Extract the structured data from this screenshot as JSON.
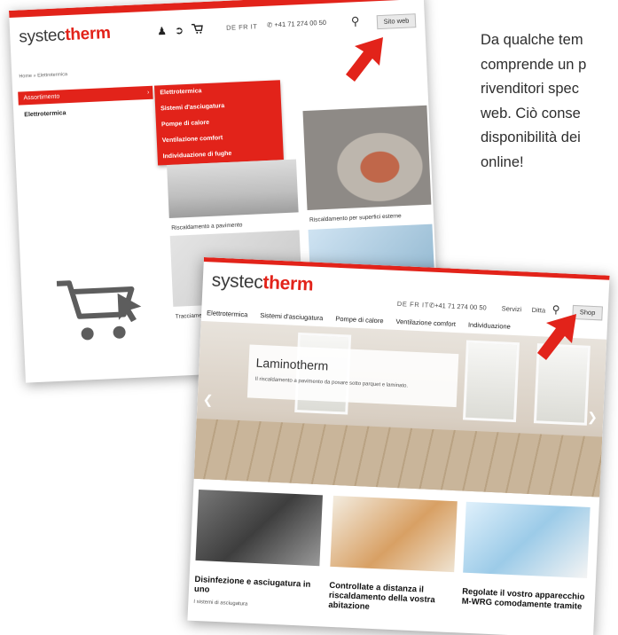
{
  "side_text": {
    "lines": [
      "Da qualche tem",
      "comprende un p",
      "rivenditori spec",
      "web. Ciò conse",
      "disponibilità dei",
      "online!"
    ]
  },
  "shot1": {
    "logo_part1": "systec",
    "logo_part2": "therm",
    "langs": "DE FR IT",
    "phone": "+41 71 274 00 50",
    "web_button": "Sito web",
    "breadcrumb": "Home  »  Elettrotermica",
    "assort_label": "Assortimento",
    "sidebar_item": "Elettrotermica",
    "menu": [
      "Elettrotermica",
      "Sistemi d'asciugatura",
      "Pompe di calore",
      "Ventilazione comfort",
      "Individuazione di fughe"
    ],
    "tiles": [
      "Riscaldamento a pavimento",
      "Riscaldamento per superfici esterne",
      "Tracciamen"
    ],
    "icons": [
      "user-icon",
      "logout-icon",
      "cart-icon",
      "phone-icon",
      "search-icon",
      "big-cart-cursor-icon"
    ]
  },
  "shot2": {
    "logo_part1": "systec",
    "logo_part2": "therm",
    "langs": "DE FR IT",
    "phone": "+41 71 274 00 50",
    "servizi": "Servizi",
    "ditta": "Ditta",
    "shop_button": "Shop",
    "nav": [
      "Elettrotermica",
      "Sistemi d'asciugatura",
      "Pompe di calore",
      "Ventilazione comfort",
      "Individuazione"
    ],
    "hero_title": "Laminotherm",
    "hero_sub": "Il riscaldamento a pavimento da posare sotto parquet e laminato.",
    "cards": [
      {
        "title": "Disinfezione e asciugatura in uno",
        "sub": "I sistemi di asciugatura"
      },
      {
        "title": "Controllate a distanza il riscaldamento della vostra abitazione",
        "sub": ""
      },
      {
        "title": "Regolate il vostro apparecchio M-WRG comodamente tramite",
        "sub": ""
      }
    ],
    "icons": [
      "phone-icon",
      "search-icon",
      "chevron-left-icon",
      "chevron-right-icon"
    ]
  },
  "colors": {
    "brand_red": "#e2231a",
    "button_grey": "#e9e9e9"
  }
}
